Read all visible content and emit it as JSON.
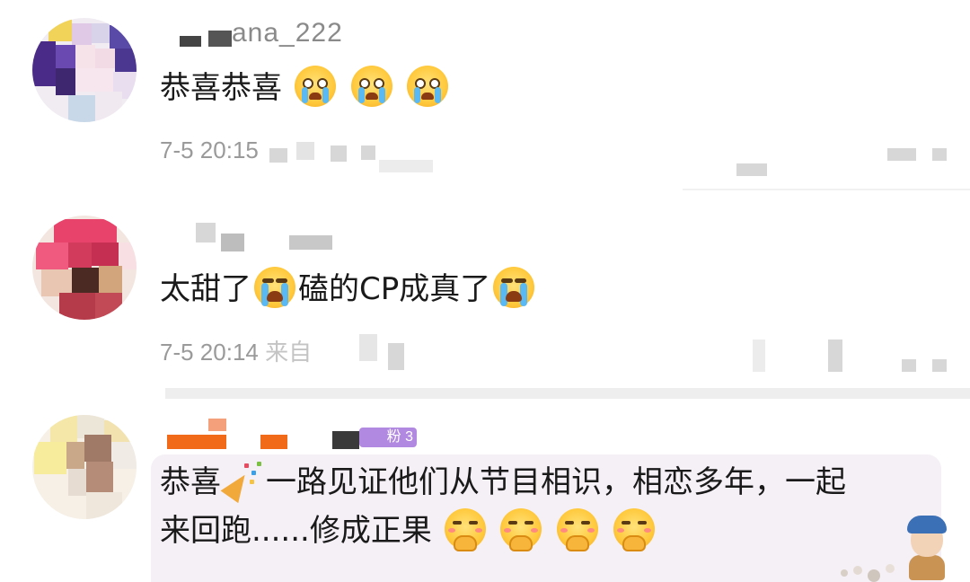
{
  "comments": [
    {
      "username": "ana_222",
      "text": "恭喜恭喜",
      "emojis": [
        "crying-face-icon",
        "crying-face-icon",
        "crying-face-icon"
      ],
      "time": "7-5 20:15"
    },
    {
      "text_before": "太甜了",
      "text_middle": "磕的CP成真了",
      "emojis": [
        "loudly-crying-face-icon",
        "loudly-crying-face-icon"
      ],
      "time": "7-5 20:14",
      "meta_suffix": "来自"
    },
    {
      "badge": "粉 3",
      "line1_a": "恭喜",
      "line1_b": "一路见证他们从节目相识，相恋多年，一起",
      "line2": "来回跑......修成正果",
      "emojis": [
        "party-popper-icon",
        "shy-face-icon",
        "shy-face-icon",
        "shy-face-icon",
        "shy-face-icon"
      ]
    }
  ],
  "colors": {
    "text": "#1a1a1a",
    "meta": "#9a9a9a",
    "bubble": "#f5f0f6",
    "badge": "#b189e0",
    "name_orange": "#f06a1a"
  }
}
